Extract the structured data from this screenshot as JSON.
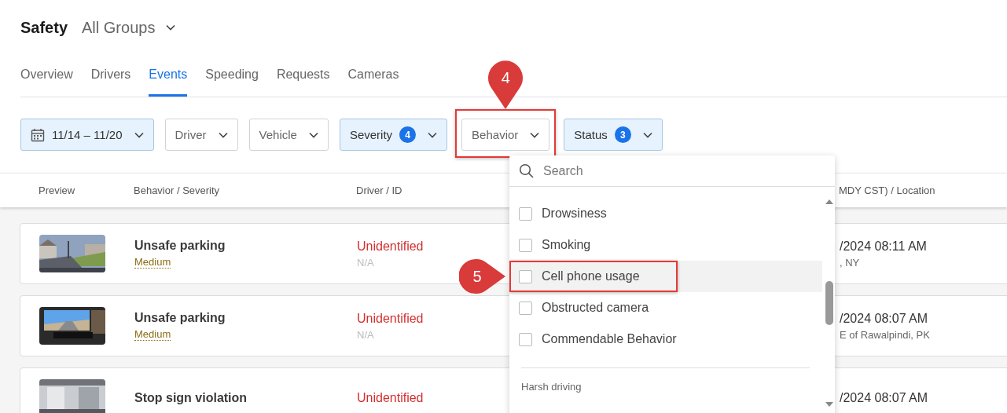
{
  "header": {
    "title": "Safety",
    "group_selector": "All Groups"
  },
  "tabs": [
    {
      "label": "Overview",
      "selected": false
    },
    {
      "label": "Drivers",
      "selected": false
    },
    {
      "label": "Events",
      "selected": true
    },
    {
      "label": "Speeding",
      "selected": false
    },
    {
      "label": "Requests",
      "selected": false
    },
    {
      "label": "Cameras",
      "selected": false
    }
  ],
  "filters": [
    {
      "kind": "date",
      "label": "11/14 – 11/20",
      "active": true
    },
    {
      "kind": "select",
      "label": "Driver",
      "active": false,
      "annotated": false
    },
    {
      "kind": "select",
      "label": "Vehicle",
      "active": false,
      "annotated": false
    },
    {
      "kind": "select",
      "label": "Severity",
      "active": true,
      "count": "4",
      "annotated": false
    },
    {
      "kind": "select",
      "label": "Behavior",
      "active": false,
      "annotated": true
    },
    {
      "kind": "select",
      "label": "Status",
      "active": true,
      "count": "3",
      "annotated": false
    }
  ],
  "table": {
    "columns": [
      "Preview",
      "Behavior / Severity",
      "Driver / ID",
      "MDY CST) / Location"
    ],
    "rows": [
      {
        "behavior": "Unsafe parking",
        "severity": "Medium",
        "driver": "Unidentified",
        "driver_id": "N/A",
        "time": "/2024 08:11 AM",
        "location": ", NY"
      },
      {
        "behavior": "Unsafe parking",
        "severity": "Medium",
        "driver": "Unidentified",
        "driver_id": "N/A",
        "time": "/2024 08:07 AM",
        "location": "E of Rawalpindi, PK"
      },
      {
        "behavior": "Stop sign violation",
        "driver": "Unidentified",
        "time": "/2024 08:07 AM"
      }
    ]
  },
  "dropdown": {
    "placeholder": "Search",
    "options": [
      {
        "label": "Drowsiness",
        "checked": false,
        "highlighted": false,
        "annotated": false
      },
      {
        "label": "Smoking",
        "checked": false,
        "highlighted": false,
        "annotated": false
      },
      {
        "label": "Cell phone usage",
        "checked": false,
        "highlighted": true,
        "annotated": true
      },
      {
        "label": "Obstructed camera",
        "checked": false,
        "highlighted": false,
        "annotated": false
      },
      {
        "label": "Commendable Behavior",
        "checked": false,
        "highlighted": false,
        "annotated": false
      }
    ],
    "group_label": "Harsh driving"
  },
  "annotations": [
    {
      "number": "4"
    },
    {
      "number": "5"
    }
  ]
}
